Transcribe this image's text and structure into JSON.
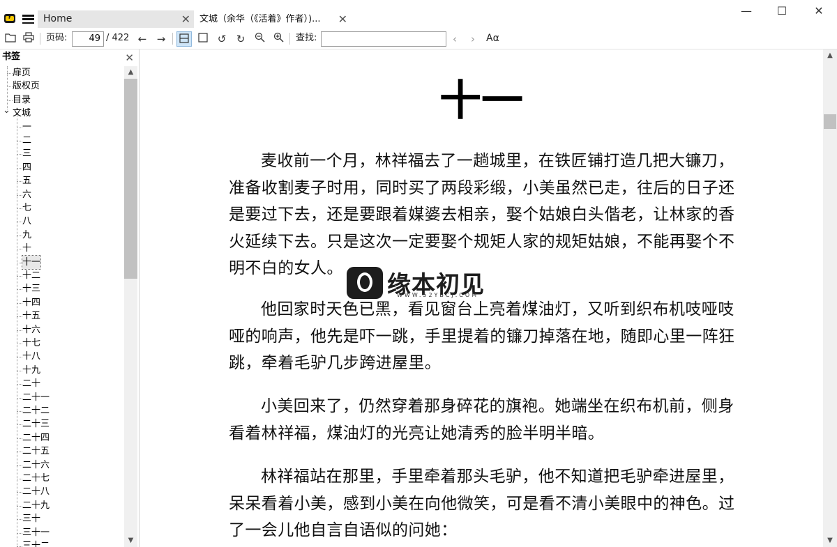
{
  "window": {
    "minimize_glyph": "—",
    "maximize_glyph": "☐",
    "close_glyph": "✕"
  },
  "tabs": [
    {
      "label": "Home",
      "active": false
    },
    {
      "label": "文城（余华（《活着》作者）)...",
      "active": true
    }
  ],
  "toolbar": {
    "page_label": "页码:",
    "page_value": "49",
    "page_total": "/ 422",
    "find_label": "查找:",
    "find_value": "",
    "font_label": "Aα",
    "icons": [
      "open-folder-icon",
      "print-icon",
      "prev-arrow-icon",
      "next-arrow-icon",
      "continuous-layout-icon",
      "single-page-icon",
      "rotate-left-icon",
      "rotate-right-icon",
      "zoom-out-icon",
      "zoom-in-icon",
      "find-prev-icon",
      "find-next-icon"
    ]
  },
  "sidebar": {
    "title": "书签",
    "items": [
      {
        "label": "扉页",
        "level": 0
      },
      {
        "label": "版权页",
        "level": 0
      },
      {
        "label": "目录",
        "level": 0
      },
      {
        "label": "文城",
        "level": 0,
        "expanded": true
      },
      {
        "label": "一",
        "level": 1
      },
      {
        "label": "二",
        "level": 1
      },
      {
        "label": "三",
        "level": 1
      },
      {
        "label": "四",
        "level": 1
      },
      {
        "label": "五",
        "level": 1
      },
      {
        "label": "六",
        "level": 1
      },
      {
        "label": "七",
        "level": 1
      },
      {
        "label": "八",
        "level": 1
      },
      {
        "label": "九",
        "level": 1
      },
      {
        "label": "十",
        "level": 1
      },
      {
        "label": "十一",
        "level": 1,
        "selected": true
      },
      {
        "label": "十二",
        "level": 1
      },
      {
        "label": "十三",
        "level": 1
      },
      {
        "label": "十四",
        "level": 1
      },
      {
        "label": "十五",
        "level": 1
      },
      {
        "label": "十六",
        "level": 1
      },
      {
        "label": "十七",
        "level": 1
      },
      {
        "label": "十八",
        "level": 1
      },
      {
        "label": "十九",
        "level": 1
      },
      {
        "label": "二十",
        "level": 1
      },
      {
        "label": "二十一",
        "level": 1
      },
      {
        "label": "二十二",
        "level": 1
      },
      {
        "label": "二十三",
        "level": 1
      },
      {
        "label": "二十四",
        "level": 1
      },
      {
        "label": "二十五",
        "level": 1
      },
      {
        "label": "二十六",
        "level": 1
      },
      {
        "label": "二十七",
        "level": 1
      },
      {
        "label": "二十八",
        "level": 1
      },
      {
        "label": "二十九",
        "level": 1
      },
      {
        "label": "三十",
        "level": 1
      },
      {
        "label": "三十一",
        "level": 1
      },
      {
        "label": "三十二",
        "level": 1
      }
    ]
  },
  "document": {
    "chapter_title": "十一",
    "paragraphs": [
      "麦收前一个月，林祥福去了一趟城里，在铁匠铺打造几把大镰刀，准备收割麦子时用，同时买了两段彩缎，小美虽然已走，往后的日子还是要过下去，还是要跟着媒婆去相亲，娶个姑娘白头偕老，让林家的香火延续下去。只是这次一定要娶个规矩人家的规矩姑娘，不能再娶个不明不白的女人。",
      "他回家时天色已黑，看见窗台上亮着煤油灯，又听到织布机吱哑吱哑的响声，他先是吓一跳，手里提着的镰刀掉落在地，随即心里一阵狂跳，牵着毛驴几步跨进屋里。",
      "小美回来了，仍然穿着那身碎花的旗袍。她端坐在织布机前，侧身看着林祥福，煤油灯的光亮让她清秀的脸半明半暗。",
      "林祥福站在那里，手里牵着那头毛驴，他不知道把毛驴牵进屋里，呆呆看着小美，感到小美在向他微笑，可是看不清小美眼中的神色。过了一会儿他自言自语似的问她："
    ]
  },
  "watermark": {
    "text": "缘本初见",
    "sub": "WWW.52YBCJ.COM"
  },
  "colors": {
    "tab_inactive": "#e6e6e6",
    "active_tool": "#cde4f7",
    "scrollbar": "#f0f0f0",
    "scroll_thumb": "#c1c1c1"
  }
}
